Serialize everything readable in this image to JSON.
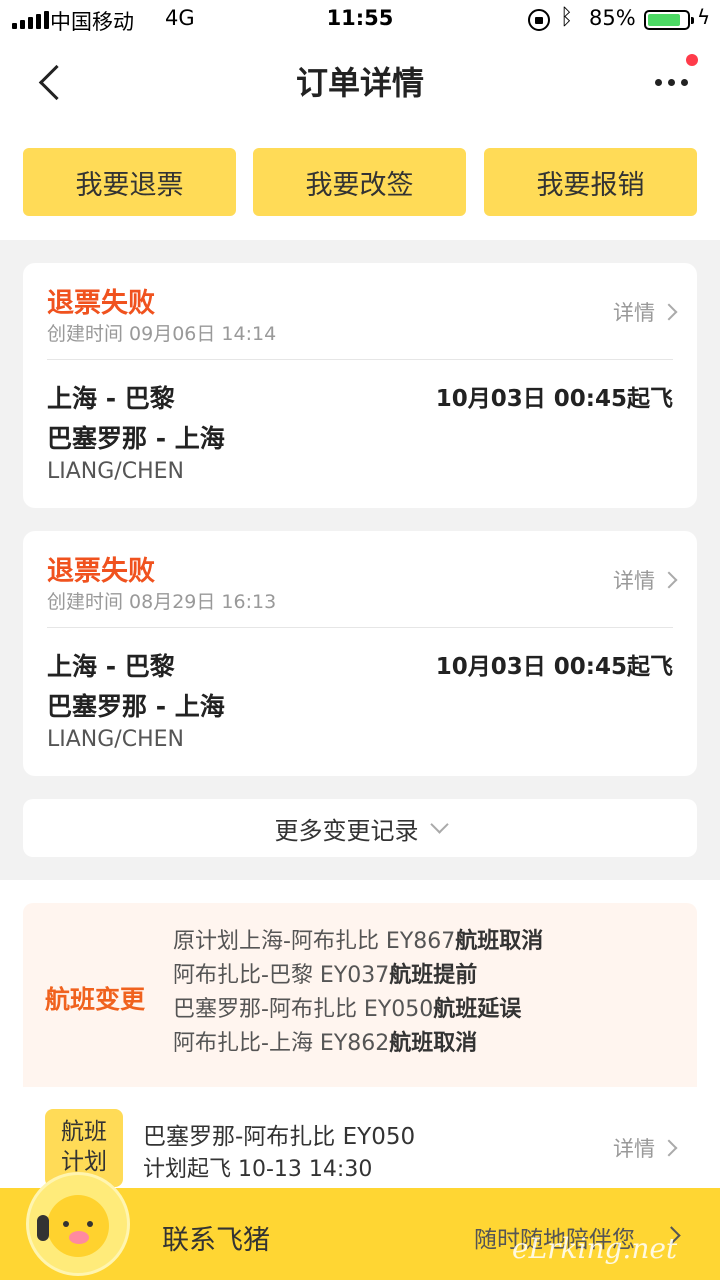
{
  "status_bar": {
    "carrier": "中国移动",
    "network": "4G",
    "time": "11:55",
    "battery_percent": "85%",
    "battery_level": 0.85,
    "icons": [
      "signal-icon",
      "lock-rotation-icon",
      "bluetooth-icon",
      "battery-icon",
      "charging-icon"
    ]
  },
  "header": {
    "title": "订单详情",
    "back_icon": "back-chevron-icon",
    "more_icon": "more-dots-icon",
    "notification_dot_color": "#ff3b4a"
  },
  "actions": {
    "refund": "我要退票",
    "change": "我要改签",
    "reimburse": "我要报销"
  },
  "records": [
    {
      "status": "退票失败",
      "created": "创建时间 09月06日 14:14",
      "detail": "详情",
      "route1": "上海 - 巴黎",
      "route2": "巴塞罗那 - 上海",
      "passenger": "LIANG/CHEN",
      "departure": "10月03日 00:45起飞"
    },
    {
      "status": "退票失败",
      "created": "创建时间 08月29日 16:13",
      "detail": "详情",
      "route1": "上海 - 巴黎",
      "route2": "巴塞罗那 - 上海",
      "passenger": "LIANG/CHEN",
      "departure": "10月03日 00:45起飞"
    }
  ],
  "more_records": "更多变更记录",
  "flight_change": {
    "label": "航班变更",
    "lines": [
      {
        "text": "原计划上海-阿布扎比 EY867",
        "status": "航班取消"
      },
      {
        "text": "阿布扎比-巴黎 EY037",
        "status": "航班提前"
      },
      {
        "text": "巴塞罗那-阿布扎比 EY050",
        "status": "航班延误"
      },
      {
        "text": "阿布扎比-上海 EY862",
        "status": "航班取消"
      }
    ]
  },
  "flight_plan": {
    "badge_line1": "航班",
    "badge_line2": "计划",
    "route": "巴塞罗那-阿布扎比 EY050",
    "time": "计划起飞 10-13 14:30",
    "detail": "详情"
  },
  "bottom_bar": {
    "contact": "联系飞猪",
    "slogan": "随时随地陪伴您",
    "watermark": "eLrking.net"
  },
  "colors": {
    "accent_yellow": "#ffdb57",
    "status_red": "#f0521e",
    "change_orange": "#f0621e",
    "bottom_bar": "#ffd633"
  }
}
